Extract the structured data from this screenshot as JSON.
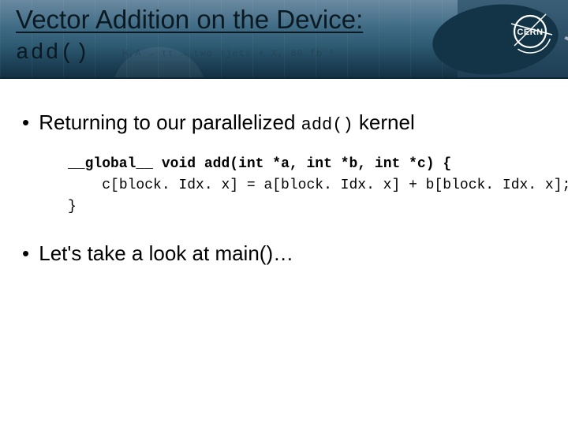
{
  "header": {
    "title": "Vector Addition on the Device:",
    "subtitle": "add()",
    "bg_formula": "H,A → ττ → two τjets + X, 60 fb⁻¹",
    "logo_text": "CERN"
  },
  "body": {
    "bullets": [
      {
        "pre": "Returning to our parallelized ",
        "code": "add()",
        "post": " kernel"
      },
      {
        "text": "Let's take a look at main()…"
      }
    ],
    "code": {
      "kw_global": "__global__",
      "kw_void": "void",
      "signature": "add(int *a, int *b, int *c) {",
      "line2": "c[block. Idx. x] = a[block. Idx. x] + b[block. Idx. x];",
      "line3": "}"
    }
  }
}
